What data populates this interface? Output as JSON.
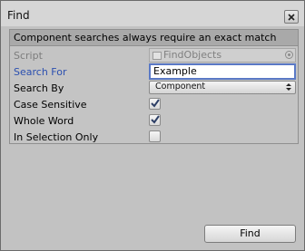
{
  "window": {
    "title": "Find"
  },
  "header": {
    "text": "Component searches always require an exact match"
  },
  "fields": {
    "script": {
      "label": "Script",
      "value": "FindObjects"
    },
    "search_for": {
      "label": "Search For",
      "value": "Example"
    },
    "search_by": {
      "label": "Search By",
      "value": "Component"
    },
    "case_sensitive": {
      "label": "Case Sensitive",
      "checked": true
    },
    "whole_word": {
      "label": "Whole Word",
      "checked": true
    },
    "in_selection_only": {
      "label": "In Selection Only",
      "checked": false
    }
  },
  "footer": {
    "find_label": "Find"
  },
  "icons": {
    "close": "close-icon",
    "script_object": "script-object-icon",
    "object_picker": "object-picker-icon",
    "dropdown": "dropdown-arrows-icon",
    "check": "checkmark-icon"
  },
  "colors": {
    "highlight_label": "#2b4fb0",
    "focus_border": "#5a79c6"
  }
}
